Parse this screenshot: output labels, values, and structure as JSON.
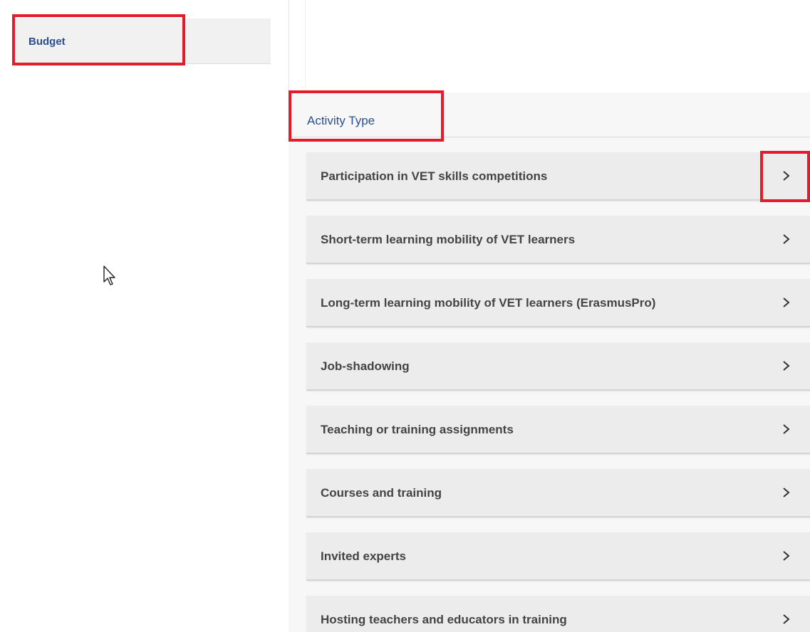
{
  "sidebar": {
    "items": [
      {
        "label": "Budget"
      }
    ]
  },
  "main": {
    "section_title": "Activity Type",
    "activities": [
      {
        "label": "Participation in VET skills competitions",
        "icon": "chevron-right-icon"
      },
      {
        "label": "Short-term learning mobility of VET learners",
        "icon": "chevron-right-icon"
      },
      {
        "label": "Long-term learning mobility of VET learners (ErasmusPro)",
        "icon": "chevron-right-icon"
      },
      {
        "label": "Job-shadowing",
        "icon": "chevron-right-icon"
      },
      {
        "label": "Teaching or training assignments",
        "icon": "chevron-right-icon"
      },
      {
        "label": "Courses and training",
        "icon": "chevron-right-icon"
      },
      {
        "label": "Invited experts",
        "icon": "chevron-right-icon"
      },
      {
        "label": "Hosting teachers and educators in training",
        "icon": "chevron-right-icon"
      }
    ]
  },
  "colors": {
    "link_blue": "#2a4e8f",
    "highlight_red": "#e31b2a",
    "item_bg": "#ececec",
    "item_text": "#444444"
  }
}
